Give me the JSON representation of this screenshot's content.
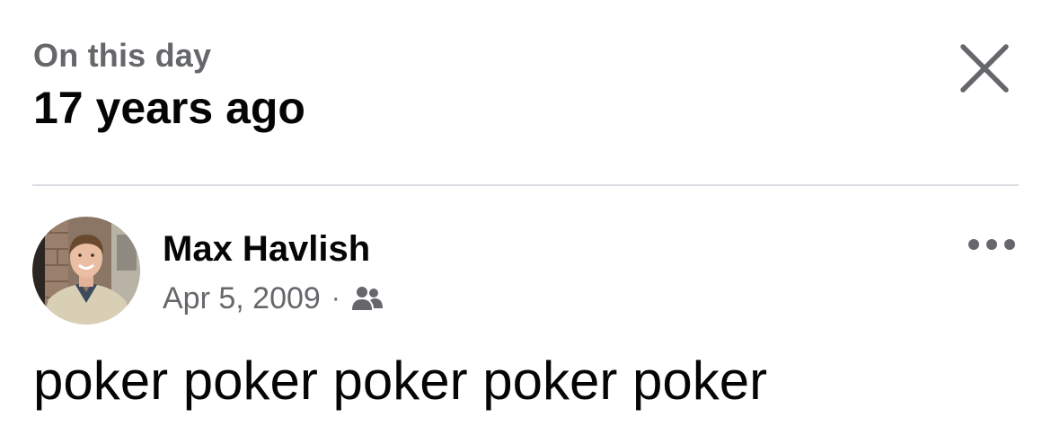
{
  "header": {
    "eyebrow": "On this day",
    "headline": "17 years ago"
  },
  "post": {
    "author": "Max Havlish",
    "date": "Apr 5, 2009",
    "separator": "·",
    "audience_icon": "friends-icon",
    "text": "poker poker poker poker poker"
  },
  "icons": {
    "close": "close-icon",
    "more": "more-options-icon"
  },
  "colors": {
    "primary_text": "#050505",
    "secondary_text": "#65676b",
    "divider": "#dadde1"
  }
}
